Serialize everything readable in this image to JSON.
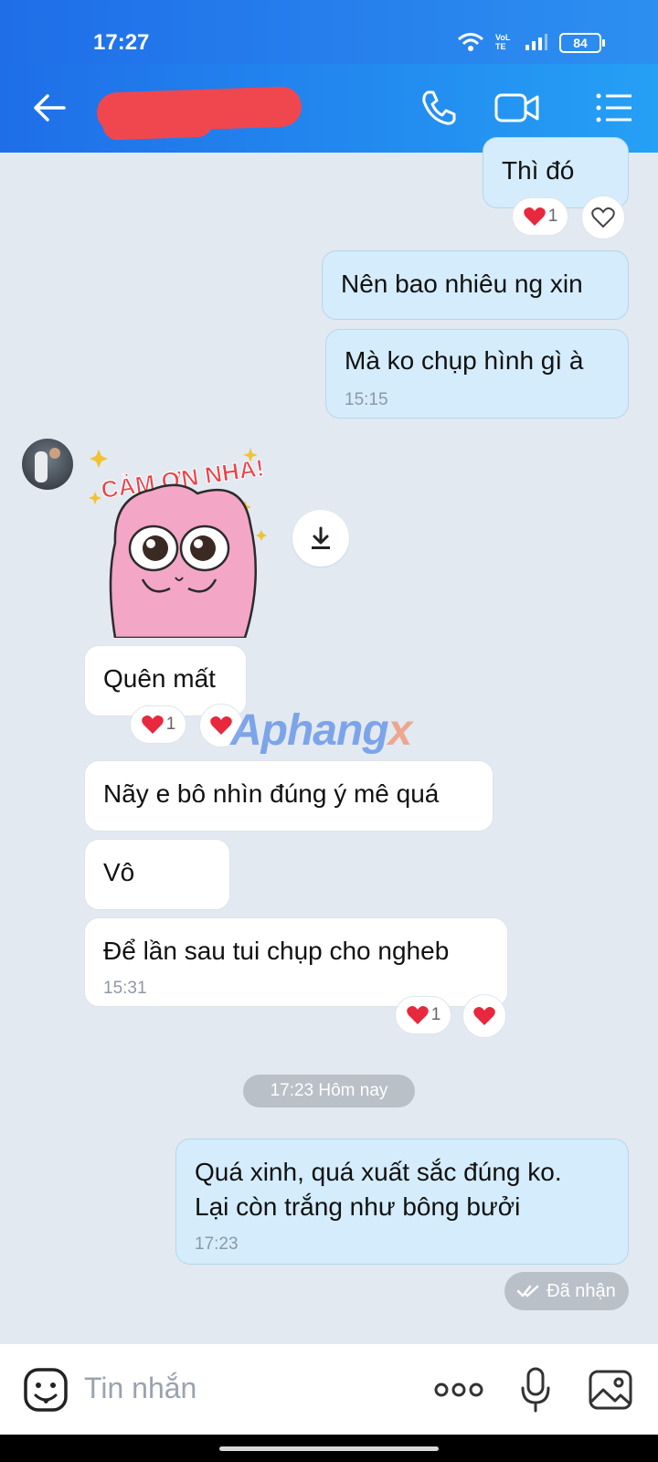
{
  "status_bar": {
    "time": "17:27",
    "battery": "84",
    "network": "VoLTE"
  },
  "header": {
    "contact_name_redacted": true,
    "back_icon": "back-arrow-icon",
    "call_icon": "phone-icon",
    "video_icon": "video-camera-icon",
    "menu_icon": "list-menu-icon"
  },
  "messages": {
    "m1": {
      "text": "Thì đó",
      "reaction_count": "1"
    },
    "m2": {
      "text": "Nên bao nhiêu ng xin"
    },
    "m3": {
      "text": "Mà ko chụp hình gì à",
      "time": "15:15"
    },
    "sticker": {
      "caption": "CẢM ƠN NHA!"
    },
    "m4": {
      "text": "Quên mất",
      "reaction_count": "1"
    },
    "m5": {
      "text": "Nãy e bô nhìn đúng ý mê quá"
    },
    "m6": {
      "text": "Vô"
    },
    "m7": {
      "text": "Để lần sau tui chụp cho ngheb",
      "time": "15:31",
      "reaction_count": "1"
    },
    "date_separator": "17:23 Hôm nay",
    "m8": {
      "line1": "Quá xinh, quá xuất sắc đúng ko.",
      "line2": "Lại còn trắng như bông bưởi",
      "time": "17:23"
    },
    "delivery_status": "Đã nhận"
  },
  "watermark": {
    "main": "Aphang",
    "tail": "x"
  },
  "composer": {
    "placeholder": "Tin nhắn"
  },
  "colors": {
    "header_start": "#1f6ee8",
    "header_end": "#25a0f5",
    "my_bubble": "#d4ecfb",
    "their_bubble": "#ffffff",
    "chat_bg": "#e2e9f1",
    "heart": "#e8283c"
  }
}
